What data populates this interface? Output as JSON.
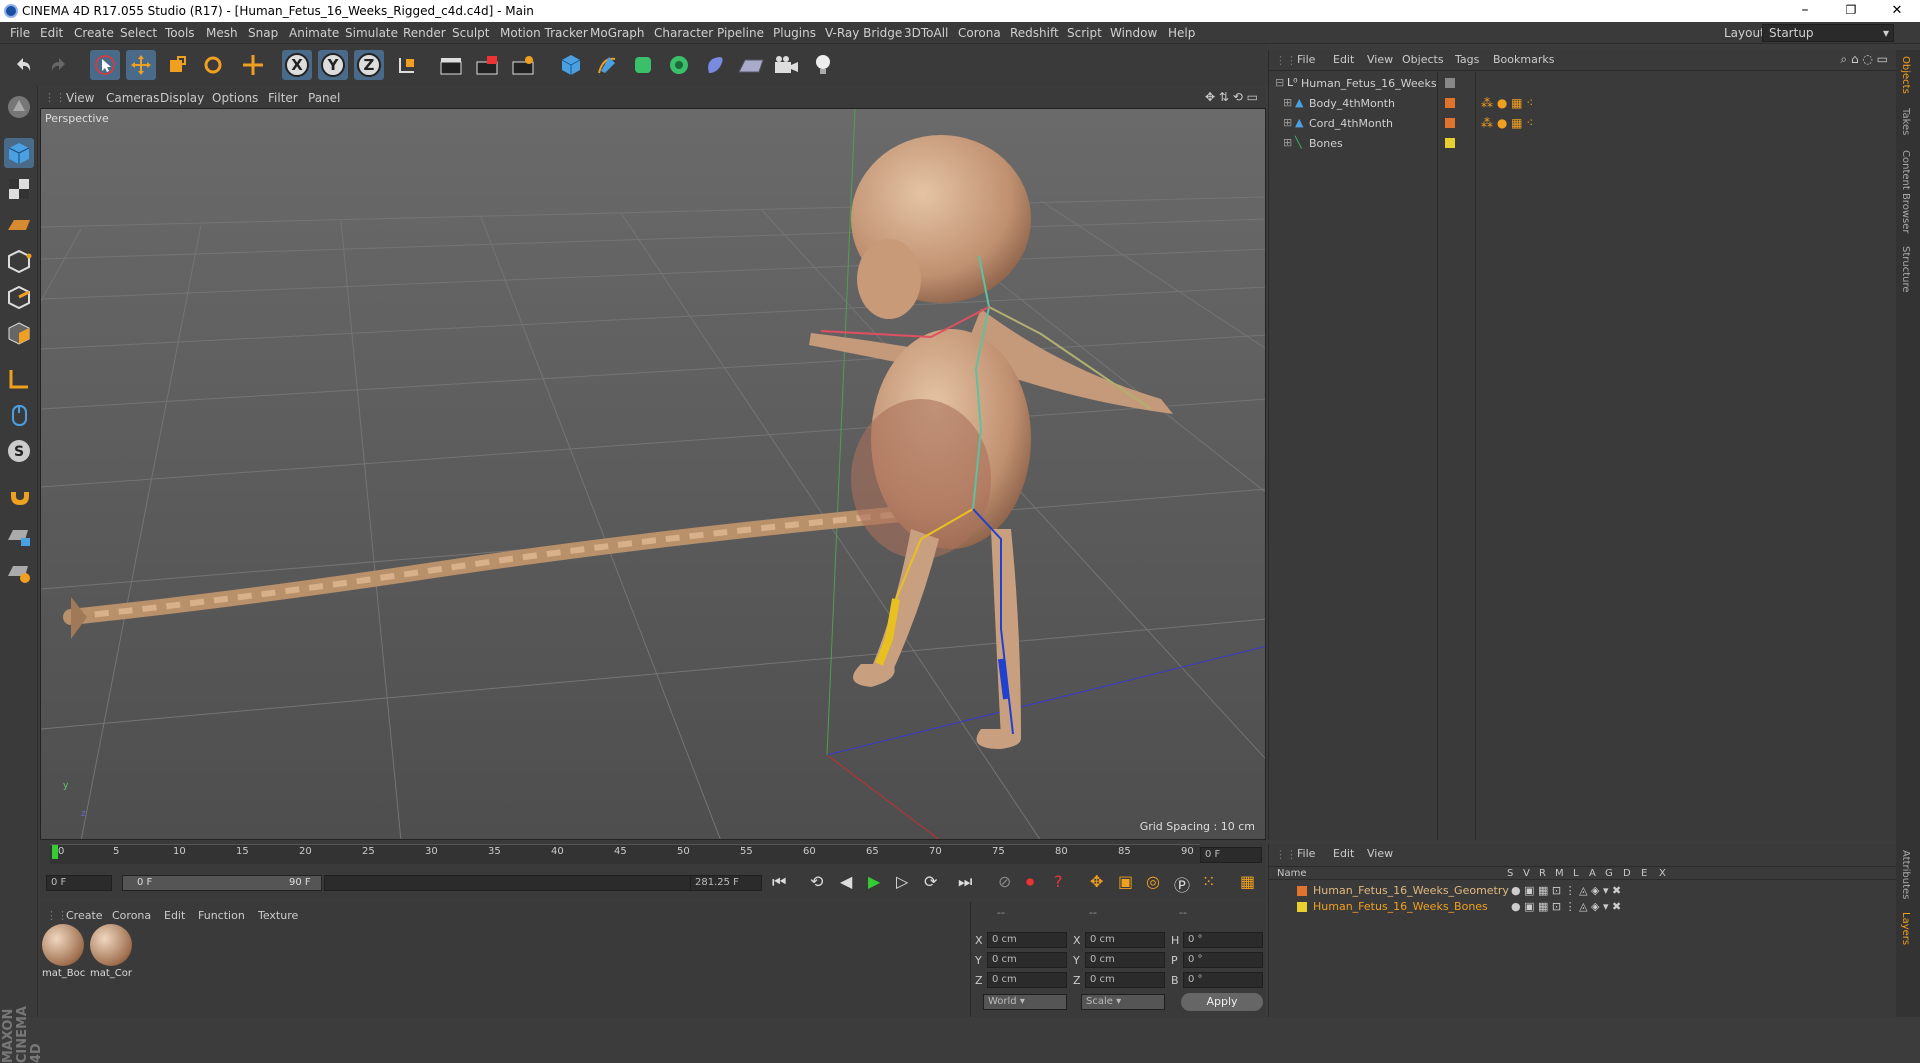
{
  "window": {
    "title": "CINEMA 4D R17.055 Studio (R17) - [Human_Fetus_16_Weeks_Rigged_c4d.c4d] - Main",
    "minimize": "–",
    "restore": "❐",
    "close": "✕"
  },
  "menu": [
    "File",
    "Edit",
    "Create",
    "Select",
    "Tools",
    "Mesh",
    "Snap",
    "Animate",
    "Simulate",
    "Render",
    "Sculpt",
    "Motion Tracker",
    "MoGraph",
    "Character",
    "Pipeline",
    "Plugins",
    "V-Ray Bridge",
    "3DToAll",
    "Corona",
    "Redshift",
    "Script",
    "Window",
    "Help"
  ],
  "layout": {
    "label": "Layout:",
    "value": "Startup"
  },
  "toolbar": {
    "axis_x": "X",
    "axis_y": "Y",
    "axis_z": "Z"
  },
  "viewport": {
    "menu": [
      "View",
      "Cameras",
      "Display",
      "Options",
      "Filter",
      "Panel"
    ],
    "label": "Perspective",
    "grid_spacing": "Grid Spacing : 10 cm",
    "axis_y": "y",
    "axis_z": "z"
  },
  "timeline": {
    "ticks": [
      "0",
      "5",
      "10",
      "15",
      "20",
      "25",
      "30",
      "35",
      "40",
      "45",
      "50",
      "55",
      "60",
      "65",
      "70",
      "75",
      "80",
      "85",
      "90"
    ],
    "frame_field": "0 F"
  },
  "transport": {
    "start": "0 F",
    "range_start": "0 F",
    "range_end": "90 F",
    "fps_field": "281.25 F"
  },
  "materials": {
    "menu": [
      "Create",
      "Corona",
      "Edit",
      "Function",
      "Texture"
    ],
    "items": [
      "mat_Boc",
      "mat_Cor"
    ]
  },
  "coords": {
    "headers": [
      "--",
      "--",
      "--"
    ],
    "rows": [
      {
        "a": "X",
        "av": "0 cm",
        "b": "X",
        "bv": "0 cm",
        "c": "H",
        "cv": "0 °"
      },
      {
        "a": "Y",
        "av": "0 cm",
        "b": "Y",
        "bv": "0 cm",
        "c": "P",
        "cv": "0 °"
      },
      {
        "a": "Z",
        "av": "0 cm",
        "b": "Z",
        "bv": "0 cm",
        "c": "B",
        "cv": "0 °"
      }
    ],
    "mode": "World",
    "scale": "Scale",
    "apply": "Apply"
  },
  "objects": {
    "menu": [
      "File",
      "Edit",
      "View",
      "Objects",
      "Tags",
      "Bookmarks"
    ],
    "items": [
      {
        "name": "Human_Fetus_16_Weeks",
        "color": "#888888"
      },
      {
        "name": "Body_4thMonth",
        "color": "#e0742c"
      },
      {
        "name": "Cord_4thMonth",
        "color": "#e0742c"
      },
      {
        "name": "Bones",
        "color": "#e8d030"
      }
    ]
  },
  "layers": {
    "menu": [
      "File",
      "Edit",
      "View"
    ],
    "cols": [
      "Name",
      "S",
      "V",
      "R",
      "M",
      "L",
      "A",
      "G",
      "D",
      "E",
      "X"
    ],
    "items": [
      {
        "name": "Human_Fetus_16_Weeks_Geometry",
        "color": "#e0742c"
      },
      {
        "name": "Human_Fetus_16_Weeks_Bones",
        "color": "#e8d030"
      }
    ]
  },
  "dock": [
    "Objects",
    "Takes",
    "Content Browser",
    "Structure",
    "Attributes",
    "Layers"
  ],
  "brand": "MAXON CINEMA 4D"
}
